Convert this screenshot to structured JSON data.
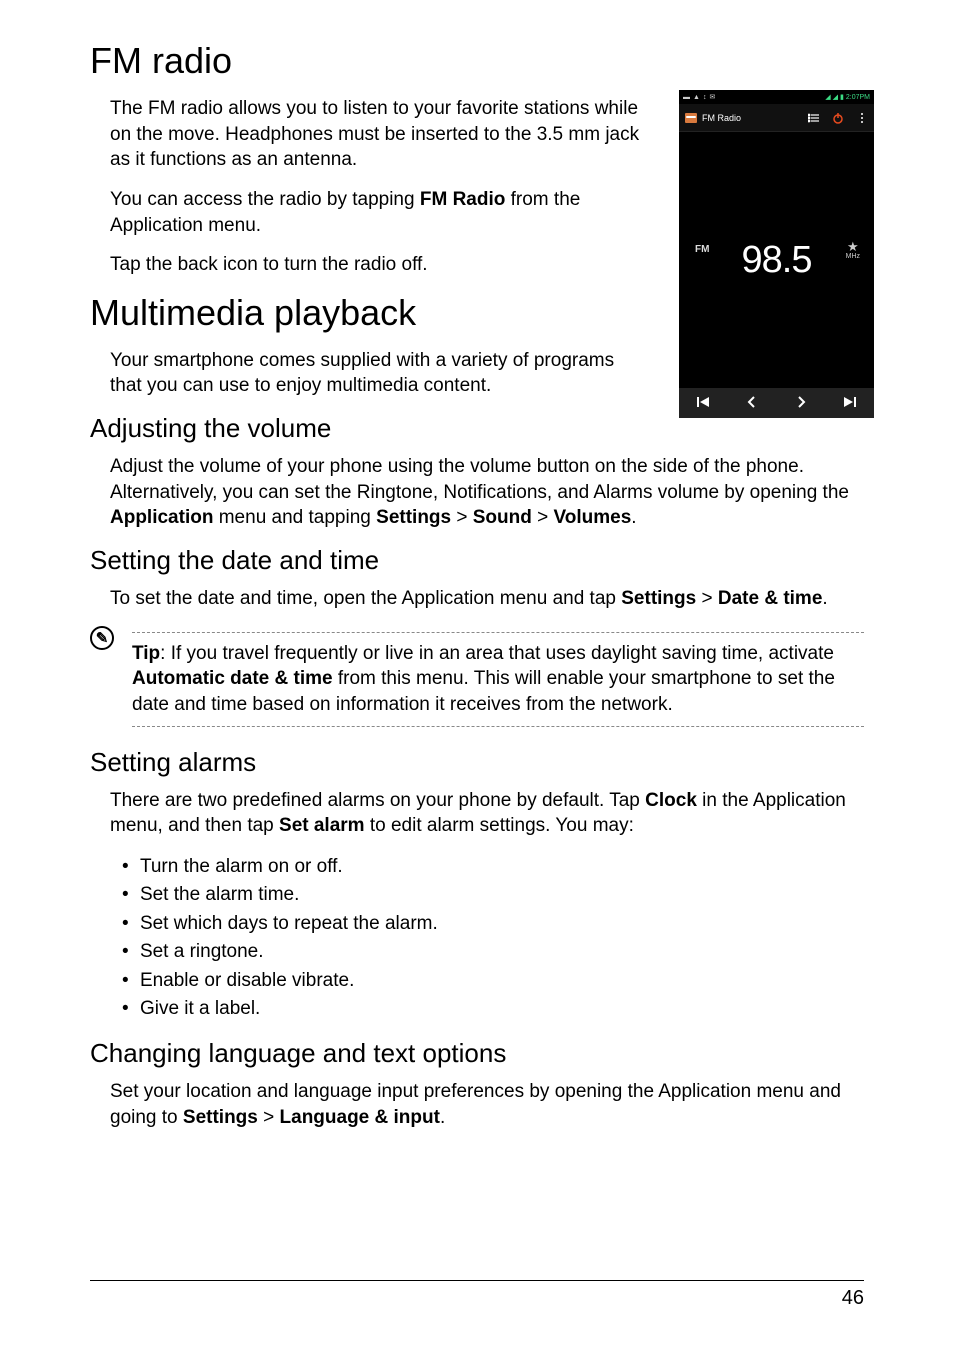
{
  "page_number": "46",
  "headings": {
    "fm_radio": "FM radio",
    "multimedia": "Multimedia playback",
    "adj_vol": "Adjusting the volume",
    "date_time": "Setting the date and time",
    "alarms": "Setting alarms",
    "lang": "Changing language and text options"
  },
  "paras": {
    "fm1": "The FM radio allows you to listen to your favorite stations while on the move. Headphones must be inserted to the 3.5 mm jack as it functions as an antenna.",
    "fm2a": "You can access the radio by tapping ",
    "fm2b": "FM Radio",
    "fm2c": " from the Application menu.",
    "fm3": "Tap the back icon to turn the radio off.",
    "mm1": "Your smartphone comes supplied with a variety of programs that you can use to enjoy multimedia content.",
    "vol1": "Adjust the volume of your phone using the volume button on the side of the phone. Alternatively, you can set the Ringtone, Notifications, and Alarms volume by opening the ",
    "vol_app": "Application",
    "vol2": " menu and tapping ",
    "vol_settings": "Settings",
    "vol_gt1": " > ",
    "vol_sound": "Sound",
    "vol_gt2": " > ",
    "vol_volumes": "Volumes",
    "vol_end": ".",
    "dt1": "To set the date and time, open the Application menu and tap ",
    "dt_settings": "Settings",
    "dt_gt": " > ",
    "dt_dt": "Date & time",
    "dt_end": ".",
    "tip_label": "Tip",
    "tip_body1": ": If you travel frequently or live in an area that uses daylight saving time, activate ",
    "tip_auto": "Automatic date & time",
    "tip_body2": " from this menu. This will enable your smartphone to set the date and time based on information it receives from the network.",
    "al1a": "There are two predefined alarms on your phone by default. Tap ",
    "al_clock": "Clock",
    "al1b": " in the Application menu, and then tap ",
    "al_set": "Set alarm",
    "al1c": " to edit alarm settings. You may:",
    "lang1a": "Set your location and language input preferences by opening the Application menu and going to ",
    "lang_settings": "Settings",
    "lang_gt": " > ",
    "lang_li": "Language & input",
    "lang_end": "."
  },
  "alarm_items": [
    "Turn the alarm on or off.",
    "Set the alarm time.",
    "Set which days to repeat the alarm.",
    "Set a ringtone.",
    "Enable or disable vibrate.",
    "Give it a label."
  ],
  "phone": {
    "status_time": "2:07PM",
    "app_title": "FM Radio",
    "fm_label": "FM",
    "frequency": "98.5",
    "mhz": "MHz",
    "star": "★",
    "icons": {
      "list": "list-icon",
      "power": "power-icon",
      "more": "more-icon",
      "prev_track": "skip-previous-icon",
      "next_track": "skip-next-icon",
      "prev": "chevron-left-icon",
      "next": "chevron-right-icon"
    }
  },
  "tip_icon_glyph": "✎"
}
